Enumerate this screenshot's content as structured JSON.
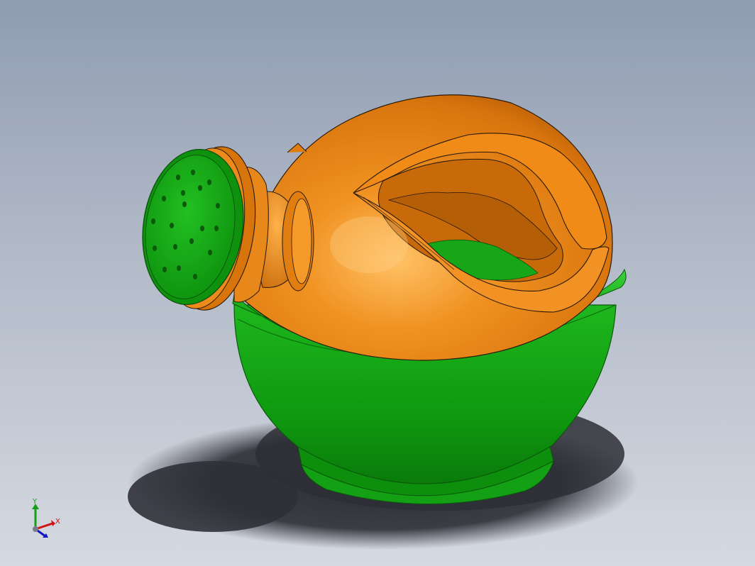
{
  "viewport": {
    "background_top": "#8f9cb1",
    "background_bottom": "#d5d9e1"
  },
  "model": {
    "body_color": "#ee8613",
    "base_color": "#129e12",
    "edge_color": "#2a1a08",
    "icon": "watering-can-3d-model"
  },
  "triad": {
    "x_label": "X",
    "y_label": "Y",
    "x_color": "#d01010",
    "y_color": "#14a014",
    "z_color": "#1414c8"
  }
}
